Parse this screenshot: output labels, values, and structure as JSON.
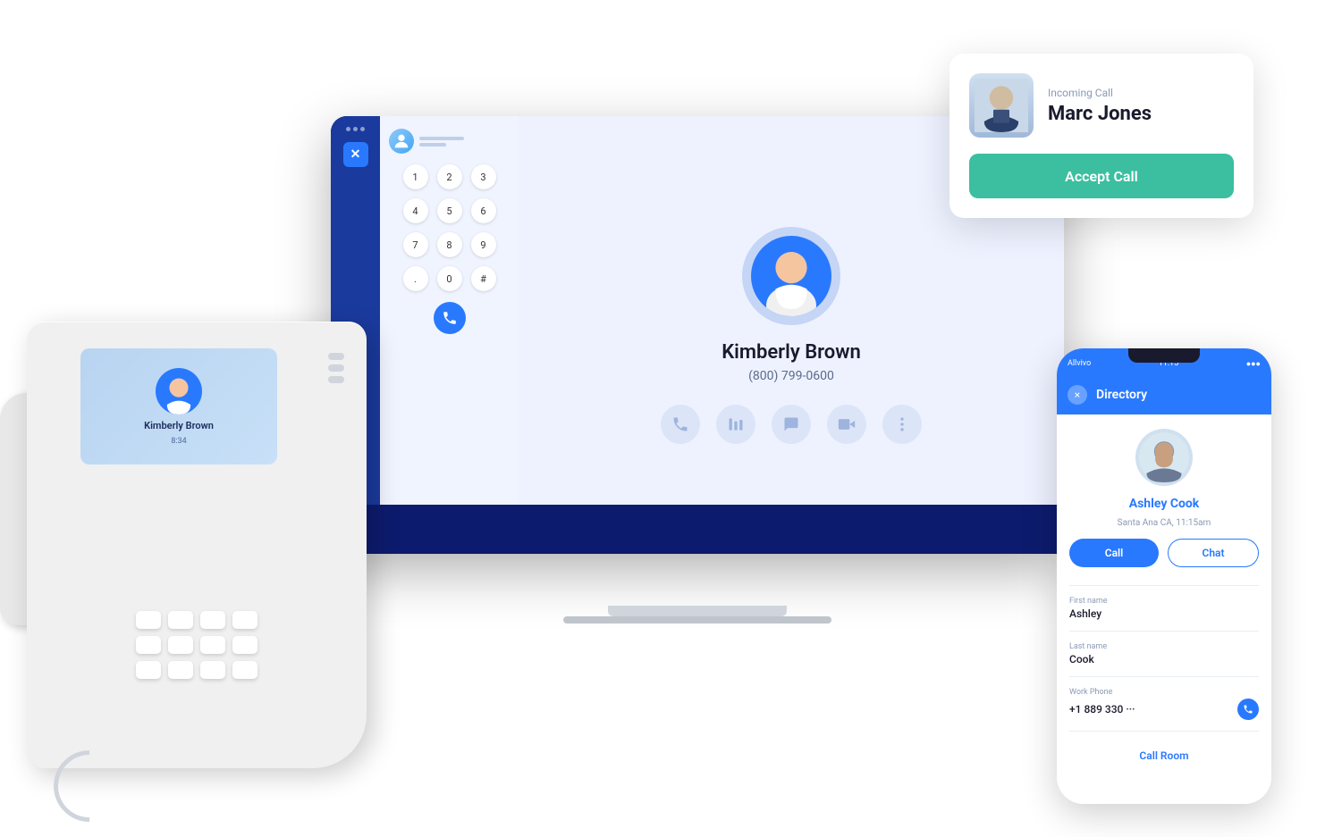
{
  "incoming_call": {
    "label": "Incoming Call",
    "caller_name": "Marc Jones",
    "accept_button_label": "Accept Call"
  },
  "laptop": {
    "dialpad": {
      "keys": [
        "1",
        "2",
        "3",
        "4",
        "5",
        "6",
        "7",
        "8",
        "9",
        ".",
        "0",
        "#"
      ]
    },
    "contact": {
      "name": "Kimberly Brown",
      "phone": "(800) 799-0600"
    }
  },
  "deskphone": {
    "screen_name": "Kimberly Brown",
    "screen_time": "8:34"
  },
  "mobile": {
    "header_title": "Directory",
    "contact": {
      "name": "Ashley Cook",
      "location": "Santa Ana CA, 11:15am",
      "first_name_label": "First name",
      "first_name": "Ashley",
      "last_name_label": "Last name",
      "last_name": "Cook",
      "work_phone_label": "Work Phone",
      "work_phone": "+1 889 330 ···"
    },
    "call_button_label": "Call",
    "chat_button_label": "Chat",
    "call_room_label": "Call Room",
    "close_button_label": "×",
    "status_bar": {
      "carrier": "Allvivo",
      "time": "11:15",
      "battery": "●●●"
    }
  }
}
